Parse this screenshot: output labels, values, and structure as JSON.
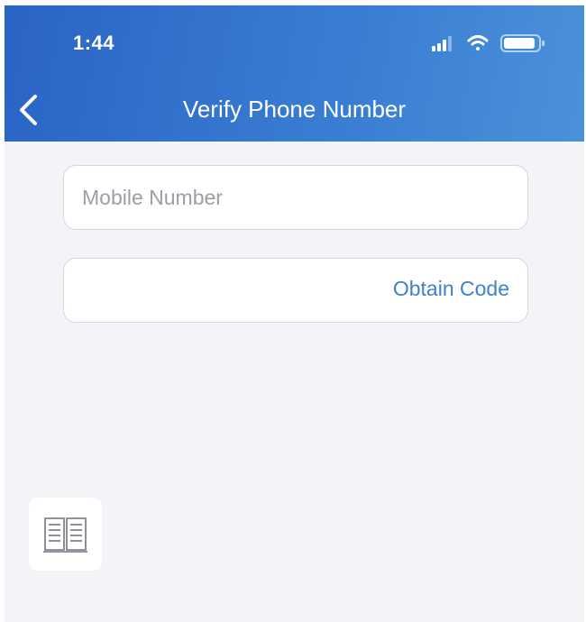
{
  "status_bar": {
    "time": "1:44",
    "icons": [
      "signal-icon",
      "wifi-icon",
      "battery-icon"
    ]
  },
  "nav": {
    "title": "Verify Phone Number",
    "back_icon": "chevron-left-icon"
  },
  "form": {
    "mobile_number": {
      "placeholder": "Mobile Number",
      "value": ""
    },
    "code": {
      "value": "",
      "obtain_label": "Obtain Code"
    }
  },
  "help_button": {
    "icon": "open-book-icon"
  },
  "colors": {
    "header_gradient_start": "#2a64c5",
    "header_gradient_end": "#4a91d8",
    "background": "#f3f4f8",
    "link": "#3f82c7",
    "placeholder": "#9a9ea6"
  }
}
